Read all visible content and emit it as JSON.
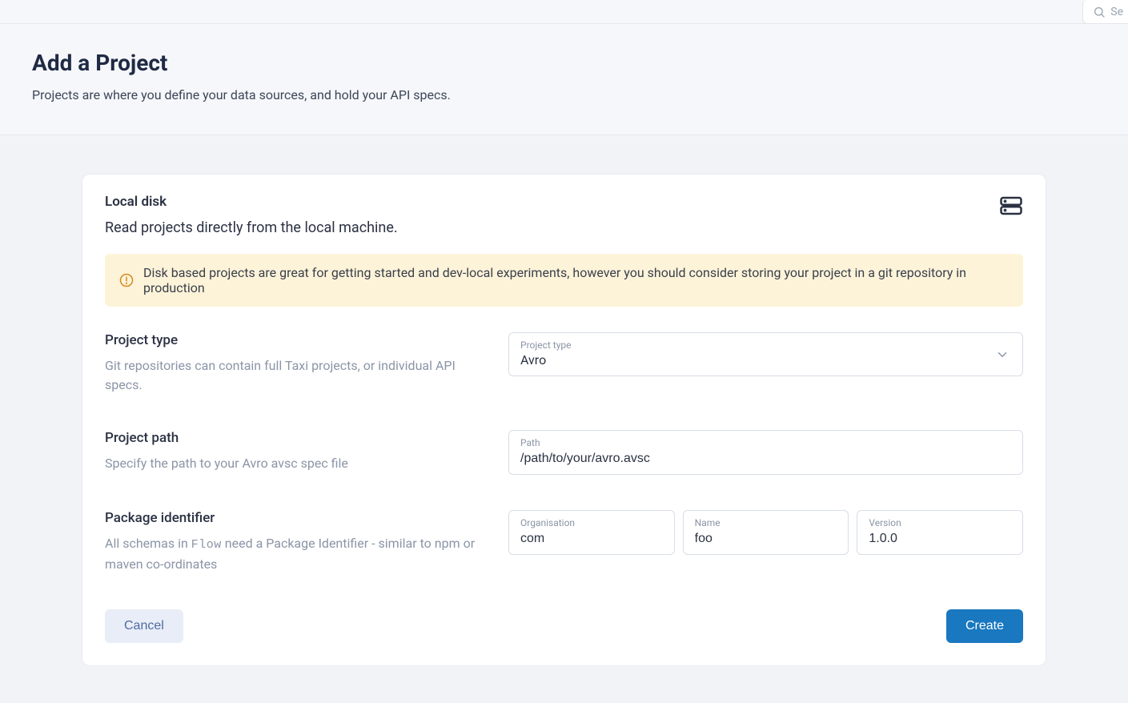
{
  "topbar": {
    "search_placeholder": "Se"
  },
  "header": {
    "title": "Add a Project",
    "subtitle": "Projects are where you define your data sources, and hold your API specs."
  },
  "card": {
    "title": "Local disk",
    "subtitle": "Read projects directly from the local machine.",
    "alert": "Disk based projects are great for getting started and dev-local experiments, however you should consider storing your project in a git repository in production"
  },
  "projectType": {
    "label": "Project type",
    "desc": "Git repositories can contain full Taxi projects, or individual API specs.",
    "floatLabel": "Project type",
    "value": "Avro"
  },
  "projectPath": {
    "label": "Project path",
    "desc": "Specify the path to your Avro avsc spec file",
    "floatLabel": "Path",
    "value": "/path/to/your/avro.avsc"
  },
  "packageIdentifier": {
    "label": "Package identifier",
    "desc_prefix": "All schemas in ",
    "desc_code": "Flow",
    "desc_suffix": " need a Package Identifier - similar to npm or maven co-ordinates",
    "org": {
      "floatLabel": "Organisation",
      "value": "com"
    },
    "name": {
      "floatLabel": "Name",
      "value": "foo"
    },
    "version": {
      "floatLabel": "Version",
      "value": "1.0.0"
    }
  },
  "actions": {
    "cancel": "Cancel",
    "create": "Create"
  }
}
